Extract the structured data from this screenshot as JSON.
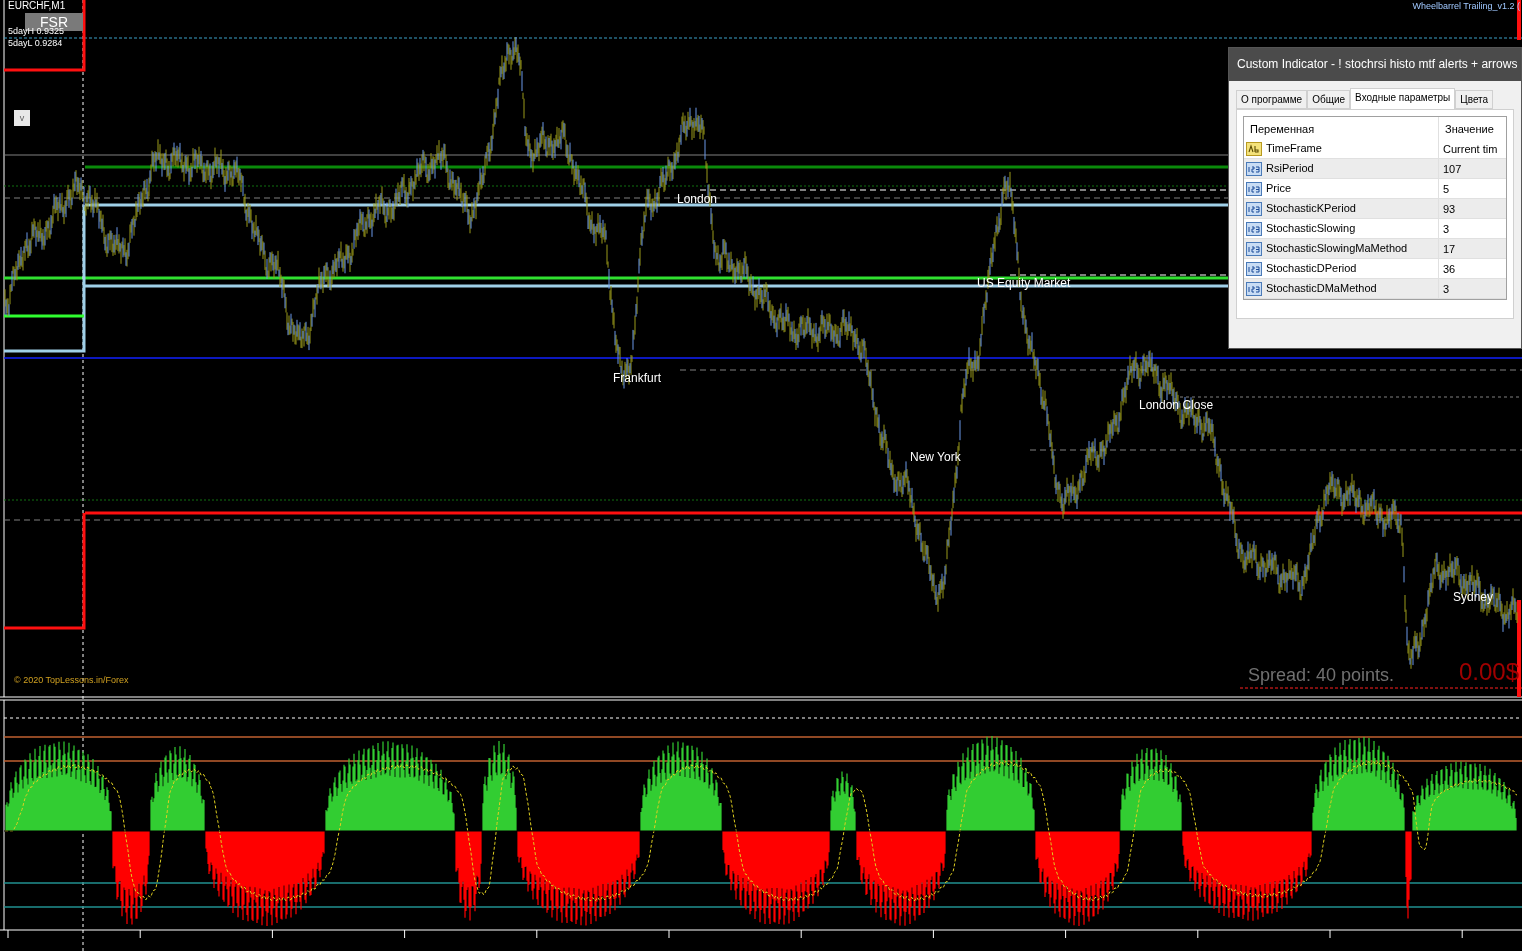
{
  "chart": {
    "symbol": "EURCHF,M1",
    "fsr_button": "FSR",
    "high_label": "5dayH 0.9325",
    "low_label": "5dayL 0.9284",
    "toggle_button": "v",
    "expert": "Wheelbarrel Trailing_v1.2 (",
    "sessions": [
      {
        "label": "London"
      },
      {
        "label": "US Equity Market"
      },
      {
        "label": "Frankfurt"
      },
      {
        "label": "London Close"
      },
      {
        "label": "New York"
      },
      {
        "label": "Sydney"
      }
    ],
    "copyright": "© 2020 TopLessons.in/Forex",
    "spread": "Spread: 40 points.",
    "profit": "0.00$"
  },
  "dialog": {
    "title": "Custom Indicator - ! stochrsi histo mtf alerts + arrows",
    "tabs": [
      {
        "label": "О программе",
        "selected": false
      },
      {
        "label": "Общие",
        "selected": false
      },
      {
        "label": "Входные параметры",
        "selected": true
      },
      {
        "label": "Цвета",
        "selected": false
      }
    ],
    "columns": [
      "Переменная",
      "Значение"
    ],
    "rows": [
      {
        "kind": "text",
        "name": "TimeFrame",
        "value": "Current tim"
      },
      {
        "kind": "number",
        "name": "RsiPeriod",
        "value": "107"
      },
      {
        "kind": "number",
        "name": "Price",
        "value": "5"
      },
      {
        "kind": "number",
        "name": "StochasticKPeriod",
        "value": "93"
      },
      {
        "kind": "number",
        "name": "StochasticSlowing",
        "value": "3"
      },
      {
        "kind": "number",
        "name": "StochasticSlowingMaMethod",
        "value": "17"
      },
      {
        "kind": "number",
        "name": "StochasticDPeriod",
        "value": "36"
      },
      {
        "kind": "number",
        "name": "StochasticDMaMethod",
        "value": "3"
      }
    ]
  }
}
